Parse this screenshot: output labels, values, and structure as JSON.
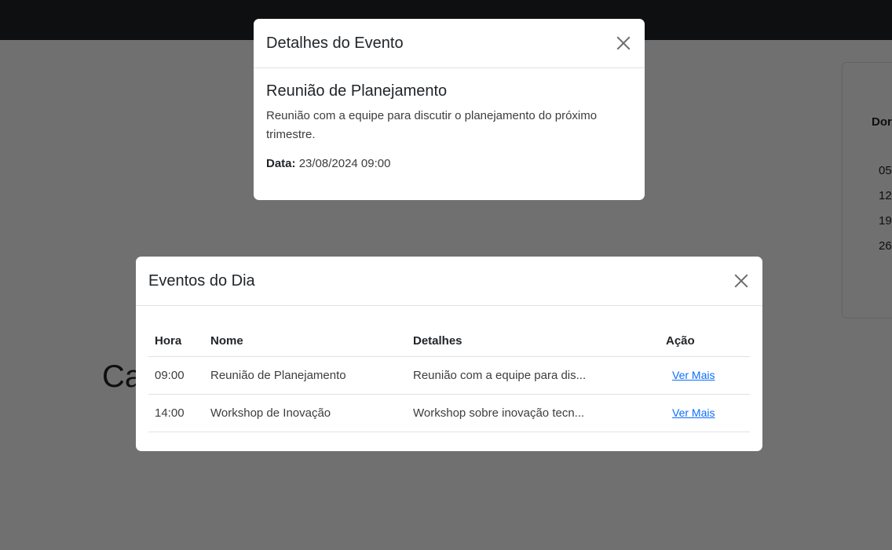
{
  "background": {
    "heading": "Ca",
    "calendar_header": "Dor",
    "calendar_days": [
      "05",
      "12",
      "19",
      "26"
    ]
  },
  "details_modal": {
    "title": "Detalhes do Evento",
    "close_icon": "close-icon",
    "event_name": "Reunião de Planejamento",
    "event_description": "Reunião com a equipe para discutir o planejamento do próximo trimestre.",
    "date_label": "Data:",
    "date_value": "23/08/2024 09:00"
  },
  "events_modal": {
    "title": "Eventos do Dia",
    "close_icon": "close-icon",
    "columns": [
      "Hora",
      "Nome",
      "Detalhes",
      "Ação"
    ],
    "rows": [
      {
        "hora": "09:00",
        "nome": "Reunião de Planejamento",
        "detalhes": "Reunião com a equipe para dis...",
        "acao": "Ver Mais"
      },
      {
        "hora": "14:00",
        "nome": "Workshop de Inovação",
        "detalhes": "Workshop sobre inovação tecn...",
        "acao": "Ver Mais"
      }
    ]
  },
  "colors": {
    "navbar": "#212529",
    "link": "#0d6efd",
    "backdrop": "#404040"
  }
}
